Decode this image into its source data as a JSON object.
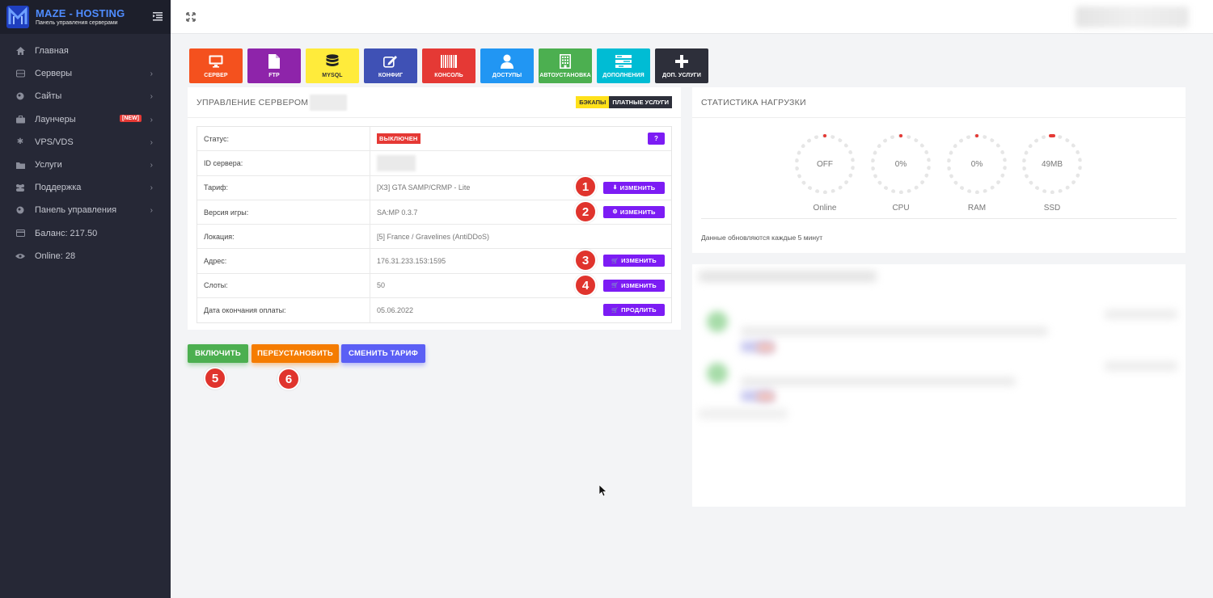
{
  "brand": {
    "name": "MAZE - HOSTING",
    "subtitle": "Панель управления серверами"
  },
  "sidebar": {
    "items": [
      {
        "label": "Главная",
        "icon": "home-icon"
      },
      {
        "label": "Серверы",
        "icon": "server-icon"
      },
      {
        "label": "Сайты",
        "icon": "globe-icon"
      },
      {
        "label": "Лаунчеры",
        "icon": "briefcase-icon",
        "badge": "[NEW]"
      },
      {
        "label": "VPS/VDS",
        "icon": "asterisk-icon"
      },
      {
        "label": "Услуги",
        "icon": "folder-icon"
      },
      {
        "label": "Поддержка",
        "icon": "users-icon"
      },
      {
        "label": "Панель управления",
        "icon": "globe-icon"
      },
      {
        "label": "Баланс: 217.50",
        "icon": "card-icon"
      },
      {
        "label": "Online: 28",
        "icon": "eye-icon"
      }
    ]
  },
  "tiles": [
    {
      "label": "СЕРВЕР",
      "color": "#f4511e",
      "icon": "monitor-icon"
    },
    {
      "label": "FTP",
      "color": "#8e24aa",
      "icon": "file-icon"
    },
    {
      "label": "MYSQL",
      "color": "#ffeb3b",
      "icon": "database-icon",
      "text_color": "#333"
    },
    {
      "label": "КОНФИГ",
      "color": "#3f51b5",
      "icon": "edit-icon"
    },
    {
      "label": "КОНСОЛЬ",
      "color": "#e53935",
      "icon": "barcode-icon"
    },
    {
      "label": "ДОСТУПЫ",
      "color": "#2196f3",
      "icon": "user-icon"
    },
    {
      "label": "АВТОУСТАНОВКА",
      "color": "#4caf50",
      "icon": "building-icon"
    },
    {
      "label": "ДОПОЛНЕНИЯ",
      "color": "#00bcd4",
      "icon": "list-icon"
    },
    {
      "label": "ДОП. УСЛУГИ",
      "color": "#2d2f3a",
      "icon": "plus-icon"
    }
  ],
  "server_card": {
    "title": "УПРАВЛЕНИЕ СЕРВЕРОМ",
    "badge_backups": "БЭКАПЫ",
    "badge_paid": "ПЛАТНЫЕ УСЛУГИ",
    "rows": [
      {
        "key": "Статус:",
        "value": "ВЫКЛЮЧЕН"
      },
      {
        "key": "ID сервера:",
        "value": ""
      },
      {
        "key": "Тариф:",
        "value": "[ХЗ] GTA SAMP/CRMP - Lite",
        "button": "ИЗМЕНИТЬ"
      },
      {
        "key": "Версия игры:",
        "value": "SA:MP 0.3.7",
        "button": "ИЗМЕНИТЬ"
      },
      {
        "key": "Локация:",
        "value": "[5] France / Gravelines (AntiDDoS)"
      },
      {
        "key": "Адрес:",
        "value": "176.31.233.153:1595",
        "button": "ИЗМЕНИТЬ"
      },
      {
        "key": "Слоты:",
        "value": "50",
        "button": "ИЗМЕНИТЬ"
      },
      {
        "key": "Дата окончания оплаты:",
        "value": "05.06.2022",
        "button": "ПРОДЛИТЬ"
      }
    ],
    "help": "?"
  },
  "markers": [
    "1",
    "2",
    "3",
    "4",
    "5",
    "6"
  ],
  "actions": {
    "start": "ВКЛЮЧИТЬ",
    "reinstall": "ПЕРЕУСТАНОВИТЬ",
    "change_tariff": "СМЕНИТЬ ТАРИФ"
  },
  "stats": {
    "title": "СТАТИСТИКА НАГРУЗКИ",
    "gauges": [
      {
        "value": "OFF",
        "label": "Online"
      },
      {
        "value": "0%",
        "label": "CPU"
      },
      {
        "value": "0%",
        "label": "RAM"
      },
      {
        "value": "49MB",
        "label": "SSD"
      }
    ],
    "note": "Данные обновляются каждые 5 минут"
  },
  "colors": {
    "accent": "#7c1cf4",
    "danger": "#e53935",
    "sidebar_bg": "#262836"
  }
}
